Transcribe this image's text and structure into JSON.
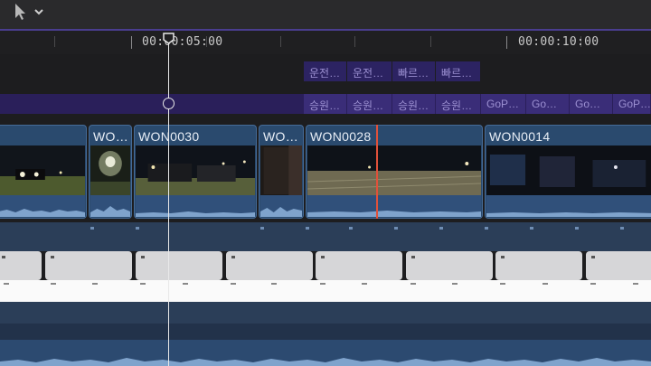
{
  "toolbar": {
    "tool_icon": "arrow-pointer-icon",
    "dropdown_icon": "chevron-down-icon"
  },
  "ruler": {
    "timecode_5s": "00:00:05:00",
    "timecode_10s": "00:00:10:00"
  },
  "connected_top": [
    "운전…",
    "운전…",
    "빠르…",
    "빠르…"
  ],
  "connected_bottom": [
    "승원…",
    "승원…",
    "승원…",
    "승원…",
    "GoP…",
    "Go…",
    "Go…",
    "GoP…"
  ],
  "primary_clips": [
    {
      "label": ""
    },
    {
      "label": "WO…"
    },
    {
      "label": "WON0030"
    },
    {
      "label": "WO…"
    },
    {
      "label": "WON0028"
    },
    {
      "label": "WON0014"
    }
  ],
  "colors": {
    "connected_clip": "#3a2d78",
    "primary_clip": "#2a4a6e",
    "skimmer": "#e0513a",
    "playhead": "#e9e9e9"
  }
}
